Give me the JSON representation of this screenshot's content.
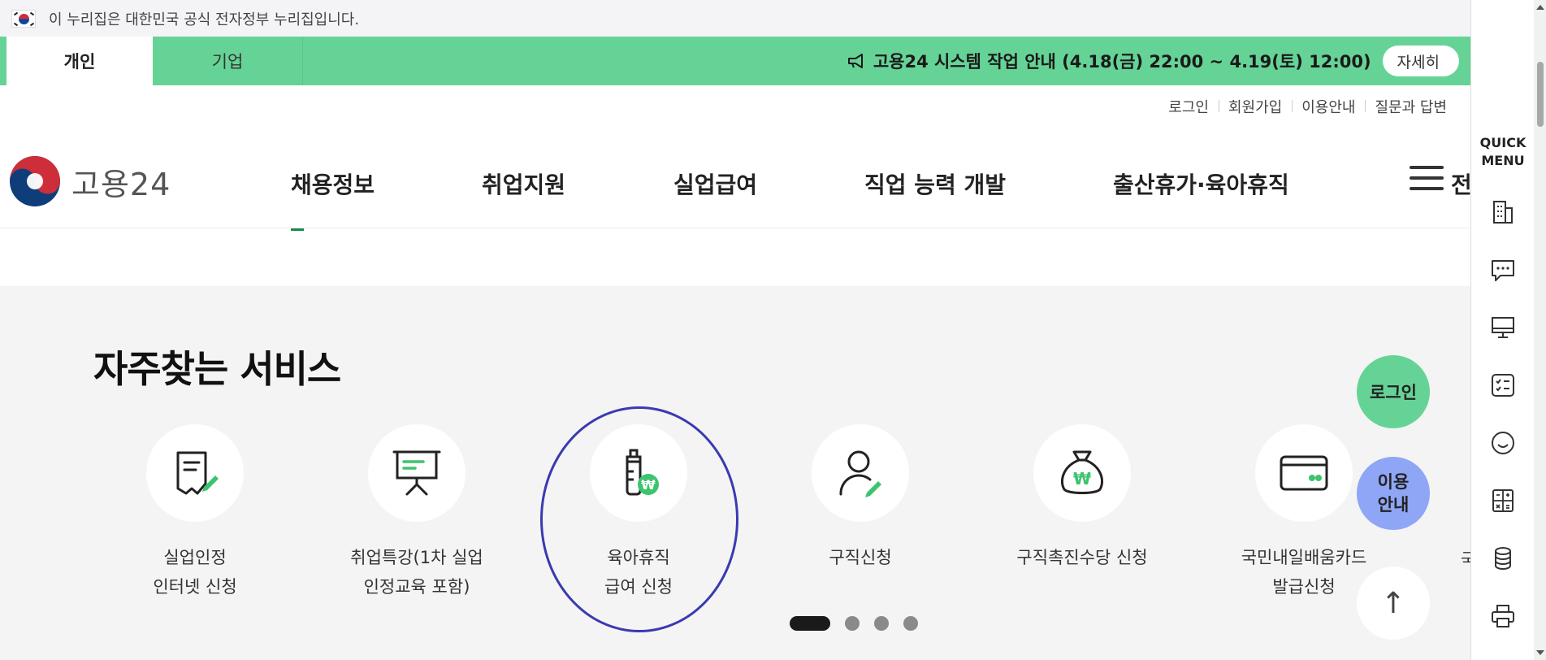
{
  "gov_banner": {
    "text": "이 누리집은 대한민국 공식 전자정부 누리집입니다."
  },
  "topbar": {
    "tabs": [
      {
        "label": "개인"
      },
      {
        "label": "기업"
      }
    ],
    "notice": "고용24 시스템 작업 안내 (4.18(금) 22:00 ~ 4.19(토) 12:00)",
    "detail_label": "자세히"
  },
  "utility_links": [
    "로그인",
    "회원가입",
    "이용안내",
    "질문과 답변"
  ],
  "logo": {
    "text": "고용24"
  },
  "gnb": {
    "items": [
      "채용정보",
      "취업지원",
      "실업급여",
      "직업 능력 개발",
      "출산휴가·육아휴직"
    ],
    "all_menu": "전체"
  },
  "services": {
    "title": "자주찾는 서비스",
    "items": [
      {
        "line1": "실업인정",
        "line2": "인터넷 신청",
        "icon": "document-edit-icon"
      },
      {
        "line1": "취업특강(1차 실업",
        "line2": "인정교육 포함)",
        "icon": "presentation-board-icon"
      },
      {
        "line1": "육아휴직",
        "line2": "급여 신청",
        "icon": "baby-bottle-won-icon"
      },
      {
        "line1": "구직신청",
        "line2": "",
        "icon": "person-edit-icon"
      },
      {
        "line1": "구직촉진수당 신청",
        "line2": "",
        "icon": "money-bag-icon"
      },
      {
        "line1": "국민내일배움카드",
        "line2": "발급신청",
        "icon": "card-icon"
      }
    ],
    "edge_text": "국"
  },
  "floating": {
    "login": "로그인",
    "guide_line1": "이용",
    "guide_line2": "안내",
    "top": "↑"
  },
  "quick_menu": {
    "title_line1": "QUICK",
    "title_line2": "MENU",
    "icons": [
      "building-icon",
      "chat-icon",
      "monitor-icon",
      "checklist-icon",
      "smile-icon",
      "calculator-icon",
      "coins-icon",
      "printer-icon"
    ]
  },
  "colors": {
    "brand_green": "#66d396",
    "accent_green": "#1d8a4c",
    "guide_blue": "#8fa5f5",
    "ring": "#3a3ab0"
  }
}
